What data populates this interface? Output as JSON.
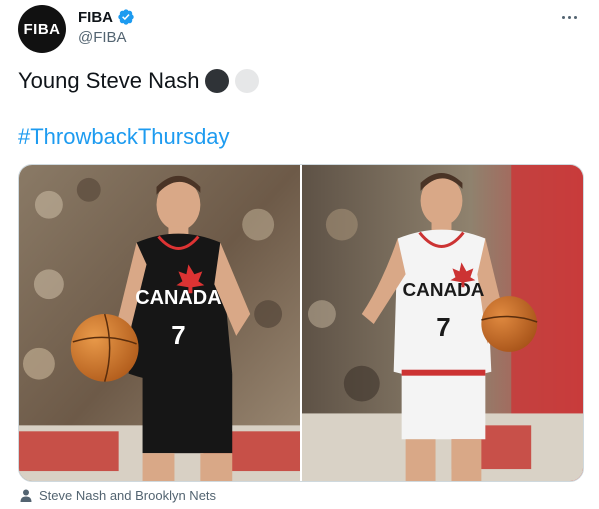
{
  "author": {
    "avatar_text": "FIBA",
    "display_name": "FIBA",
    "handle": "@FIBA",
    "verified_icon": "verified-badge-icon"
  },
  "tweet": {
    "text": "Young Steve Nash",
    "emojis": [
      "black-circle",
      "white-circle"
    ],
    "hashtag": "#ThrowbackThursday"
  },
  "media": {
    "photos": [
      {
        "jersey_text": "CANADA",
        "jersey_number": "7",
        "jersey_color": "#161616"
      },
      {
        "jersey_text": "CANADA",
        "jersey_number": "7",
        "jersey_color": "#f4f4f4"
      }
    ]
  },
  "tagged": {
    "icon": "person-icon",
    "text": "Steve Nash and Brooklyn Nets"
  },
  "colors": {
    "accent": "#1d9bf0",
    "secondary_text": "#536471",
    "primary_text": "#0f1419"
  }
}
